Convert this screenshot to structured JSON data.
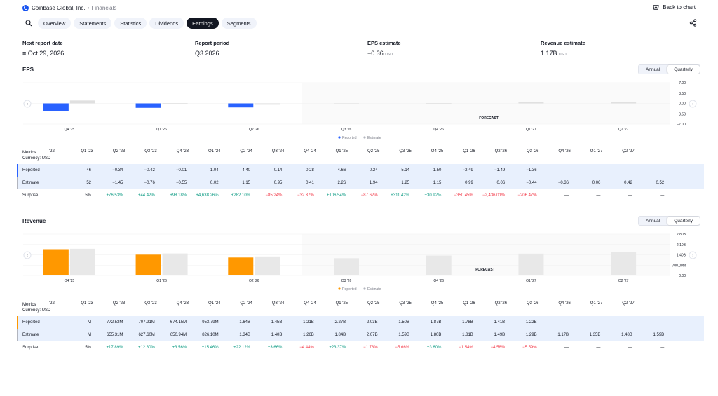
{
  "header": {
    "company": "Coinbase Global, Inc.",
    "separator": "•",
    "section": "Financials",
    "back_label": "Back to chart"
  },
  "tabs": [
    "Overview",
    "Statements",
    "Statistics",
    "Dividends",
    "Earnings",
    "Segments"
  ],
  "active_tab": "Earnings",
  "info": [
    {
      "label": "Next report date",
      "value": "Oct 29, 2026",
      "prefix": "≡",
      "unit": ""
    },
    {
      "label": "Report period",
      "value": "Q3 2026",
      "prefix": "",
      "unit": ""
    },
    {
      "label": "EPS estimate",
      "value": "−0.36",
      "prefix": "",
      "unit": "USD"
    },
    {
      "label": "Revenue estimate",
      "value": "1.17B",
      "prefix": "",
      "unit": "USD"
    }
  ],
  "eps": {
    "title": "EPS",
    "toggle": [
      "Annual",
      "Quarterly"
    ],
    "forecast_label": "FORECAST",
    "legend": [
      "Reported",
      "Estimate"
    ],
    "y_ticks": [
      "7.00",
      "3.50",
      "0.00",
      "−3.50",
      "−7.00"
    ],
    "x_ticks": [
      "Q4 '25",
      "Q1 '26",
      "Q2 '26",
      "Q3 '26",
      "Q4 '26",
      "Q1 '27",
      "Q2 '27"
    ],
    "metrics_label": "Metrics",
    "currency_label": "Currency: USD",
    "columns": [
      "'22",
      "Q1 '23",
      "Q2 '23",
      "Q3 '23",
      "Q4 '23",
      "Q1 '24",
      "Q2 '24",
      "Q3 '24",
      "Q4 '24",
      "Q1 '25",
      "Q2 '25",
      "Q3 '25",
      "Q4 '25",
      "Q1 '26",
      "Q2 '26",
      "Q3 '26",
      "Q4 '26",
      "Q1 '27",
      "Q2 '27"
    ],
    "rows": [
      {
        "label": "Reported",
        "values": [
          "46",
          "−0.34",
          "−0.42",
          "−0.01",
          "1.04",
          "4.40",
          "0.14",
          "0.28",
          "4.66",
          "0.24",
          "5.14",
          "1.50",
          "−2.49",
          "−1.49",
          "−1.36",
          "—",
          "—",
          "—",
          "—"
        ]
      },
      {
        "label": "Estimate",
        "values": [
          "52",
          "−1.45",
          "−0.76",
          "−0.55",
          "0.02",
          "1.15",
          "0.95",
          "0.41",
          "2.26",
          "1.94",
          "1.25",
          "1.15",
          "0.99",
          "0.06",
          "−0.44",
          "−0.36",
          "0.06",
          "0.42",
          "0.52"
        ]
      },
      {
        "label": "Surprise",
        "values": [
          "5%",
          "+76.53%",
          "+44.42%",
          "+98.18%",
          "+4,638.26%",
          "+282.10%",
          "−85.24%",
          "−32.37%",
          "+106.54%",
          "−87.62%",
          "+311.42%",
          "+30.92%",
          "−350.45%",
          "−2,436.01%",
          "−206.47%",
          "—",
          "—",
          "—",
          "—"
        ]
      }
    ]
  },
  "revenue": {
    "title": "Revenue",
    "toggle": [
      "Annual",
      "Quarterly"
    ],
    "forecast_label": "FORECAST",
    "legend": [
      "Reported",
      "Estimate"
    ],
    "y_ticks": [
      "2.80B",
      "2.10B",
      "1.40B",
      "700.00M",
      "0.00"
    ],
    "x_ticks": [
      "Q4 '25",
      "Q1 '26",
      "Q2 '26",
      "Q3 '26",
      "Q4 '26",
      "Q1 '27",
      "Q2 '27"
    ],
    "metrics_label": "Metrics",
    "currency_label": "Currency: USD",
    "columns": [
      "'22",
      "Q1 '23",
      "Q2 '23",
      "Q3 '23",
      "Q4 '23",
      "Q1 '24",
      "Q2 '24",
      "Q3 '24",
      "Q4 '24",
      "Q1 '25",
      "Q2 '25",
      "Q3 '25",
      "Q4 '25",
      "Q1 '26",
      "Q2 '26",
      "Q3 '26",
      "Q4 '26",
      "Q1 '27",
      "Q2 '27"
    ],
    "rows": [
      {
        "label": "Reported",
        "values": [
          "M",
          "772.53M",
          "707.91M",
          "674.15M",
          "953.79M",
          "1.64B",
          "1.45B",
          "1.21B",
          "2.27B",
          "2.03B",
          "1.50B",
          "1.87B",
          "1.78B",
          "1.41B",
          "1.22B",
          "—",
          "—",
          "—",
          "—"
        ]
      },
      {
        "label": "Estimate",
        "values": [
          "M",
          "655.31M",
          "627.60M",
          "650.94M",
          "826.10M",
          "1.34B",
          "1.40B",
          "1.26B",
          "1.84B",
          "2.07B",
          "1.59B",
          "1.80B",
          "1.81B",
          "1.49B",
          "1.29B",
          "1.17B",
          "1.35B",
          "1.48B",
          "1.59B"
        ]
      },
      {
        "label": "Surprise",
        "values": [
          "5%",
          "+17.89%",
          "+12.80%",
          "+3.56%",
          "+15.46%",
          "+22.12%",
          "+3.66%",
          "−4.44%",
          "+23.37%",
          "−1.78%",
          "−5.66%",
          "+3.60%",
          "−1.54%",
          "−4.58%",
          "−5.59%",
          "—",
          "—",
          "—",
          "—"
        ]
      }
    ]
  },
  "chart_data": [
    {
      "type": "bar",
      "title": "EPS",
      "categories": [
        "Q4 '25",
        "Q1 '26",
        "Q2 '26",
        "Q3 '26",
        "Q4 '26",
        "Q1 '27",
        "Q2 '27"
      ],
      "series": [
        {
          "name": "Reported",
          "values": [
            -2.49,
            -1.49,
            -1.36,
            null,
            null,
            null,
            null
          ]
        },
        {
          "name": "Estimate",
          "values": [
            0.99,
            0.06,
            -0.44,
            -0.36,
            0.06,
            0.42,
            0.52
          ]
        }
      ],
      "ylim": [
        -7,
        7
      ],
      "colors": {
        "Reported": "#2962ff",
        "Estimate": "#e0e0e0"
      }
    },
    {
      "type": "bar",
      "title": "Revenue",
      "categories": [
        "Q4 '25",
        "Q1 '26",
        "Q2 '26",
        "Q3 '26",
        "Q4 '26",
        "Q1 '27",
        "Q2 '27"
      ],
      "series": [
        {
          "name": "Reported",
          "values": [
            1.78,
            1.41,
            1.22,
            null,
            null,
            null,
            null
          ]
        },
        {
          "name": "Estimate",
          "values": [
            1.81,
            1.49,
            1.29,
            1.17,
            1.35,
            1.48,
            1.59
          ]
        }
      ],
      "ylim": [
        0,
        2.8
      ],
      "colors": {
        "Reported": "#ff9800",
        "Estimate": "#e8e8e8"
      }
    }
  ],
  "colors": {
    "eps_reported": "#2962ff",
    "rev_reported": "#ff9800",
    "estimate": "#e3e3e3",
    "highlight": "#e8f0fd",
    "positive": "#089981",
    "negative": "#f23645"
  }
}
